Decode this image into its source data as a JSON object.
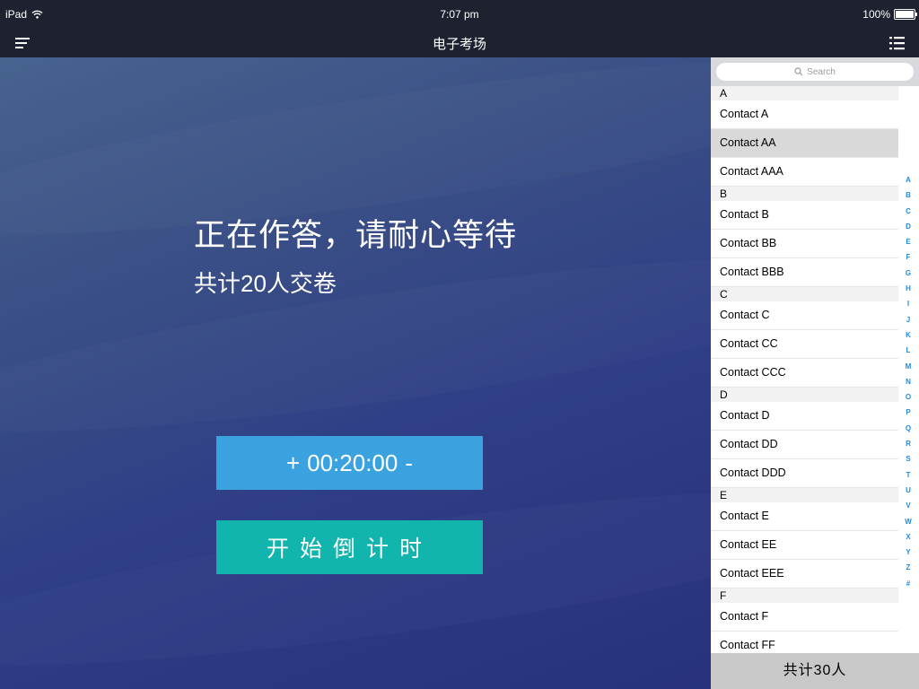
{
  "statusbar": {
    "carrier": "iPad",
    "time": "7:07 pm",
    "battery": "100%"
  },
  "navbar": {
    "title": "电子考场",
    "menu_icon": "hamburger-menu-icon",
    "list_icon": "list-icon"
  },
  "main": {
    "heading": "正在作答，请耐心等待",
    "subheading": "共计20人交卷",
    "timer": {
      "plus": "+",
      "value": "00:20:00",
      "minus": "-"
    },
    "start_label": "开始倒计时"
  },
  "panel": {
    "search_placeholder": "Search",
    "sections": [
      {
        "letter": "A",
        "contacts": [
          "Contact A",
          "Contact AA",
          "Contact AAA"
        ]
      },
      {
        "letter": "B",
        "contacts": [
          "Contact B",
          "Contact BB",
          "Contact BBB"
        ]
      },
      {
        "letter": "C",
        "contacts": [
          "Contact C",
          "Contact CC",
          "Contact CCC"
        ]
      },
      {
        "letter": "D",
        "contacts": [
          "Contact D",
          "Contact DD",
          "Contact DDD"
        ]
      },
      {
        "letter": "E",
        "contacts": [
          "Contact E",
          "Contact EE",
          "Contact EEE"
        ]
      },
      {
        "letter": "F",
        "contacts": [
          "Contact F",
          "Contact FF"
        ]
      }
    ],
    "selected_contact": "Contact AA",
    "index_letters": [
      "A",
      "B",
      "C",
      "D",
      "E",
      "F",
      "G",
      "H",
      "I",
      "J",
      "K",
      "L",
      "M",
      "N",
      "O",
      "P",
      "Q",
      "R",
      "S",
      "T",
      "U",
      "V",
      "W",
      "X",
      "Y",
      "Z",
      "#"
    ],
    "footer": "共计30人"
  },
  "colors": {
    "bar_background": "#1e2130",
    "timer_button": "#3aa3df",
    "start_button": "#12b5ad",
    "index_letters": "#1d8be6"
  }
}
